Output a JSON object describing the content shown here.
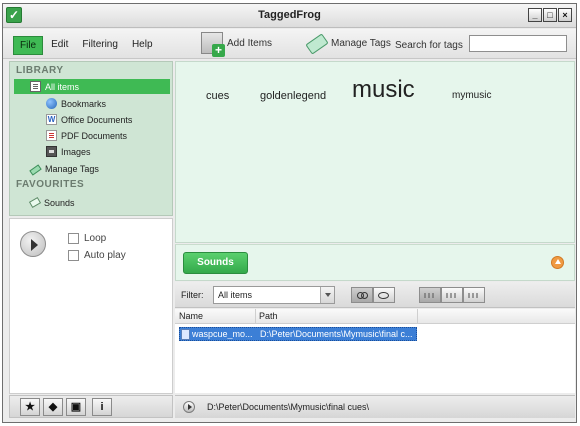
{
  "window": {
    "title": "TaggedFrog",
    "minimize": "_",
    "maximize": "□",
    "close": "×"
  },
  "menu": {
    "file": "File",
    "edit": "Edit",
    "filtering": "Filtering",
    "help": "Help"
  },
  "toolbar": {
    "add_items": "Add Items",
    "manage_tags": "Manage Tags",
    "search_label": "Search for tags",
    "search_value": ""
  },
  "sidebar": {
    "library_heading": "LIBRARY",
    "items": [
      {
        "label": "All items",
        "icon": "all-items-icon"
      },
      {
        "label": "Bookmarks",
        "icon": "globe-icon"
      },
      {
        "label": "Office Documents",
        "icon": "word-icon"
      },
      {
        "label": "PDF Documents",
        "icon": "pdf-icon"
      },
      {
        "label": "Images",
        "icon": "image-icon"
      },
      {
        "label": "Manage Tags",
        "icon": "tag-pen-icon"
      }
    ],
    "favourites_heading": "FAVOURITES",
    "favourites": [
      {
        "label": "Sounds",
        "icon": "tag-icon"
      }
    ]
  },
  "player": {
    "loop": "Loop",
    "autoplay": "Auto play",
    "loop_checked": false,
    "autoplay_checked": false
  },
  "bottom_tools": [
    "★",
    "◆",
    "▣",
    "i"
  ],
  "cloud": {
    "tags": [
      "cues",
      "goldenlegend",
      "music",
      "mymusic"
    ]
  },
  "tagbar": {
    "active_tag": "Sounds"
  },
  "filter": {
    "label": "Filter:",
    "selected": "All items"
  },
  "table": {
    "headers": [
      "Name",
      "Path"
    ],
    "rows": [
      {
        "name": "waspcue_mo...",
        "path": "D:\\Peter\\Documents\\Mymusic\\final c..."
      }
    ]
  },
  "status": {
    "path": "D:\\Peter\\Documents\\Mymusic\\final cues\\"
  },
  "colors": {
    "accent": "#3fba54",
    "cloud_bg": "#e6f6ec",
    "sidebar_bg": "#cfe5d4",
    "selection": "#3c7fd6"
  }
}
